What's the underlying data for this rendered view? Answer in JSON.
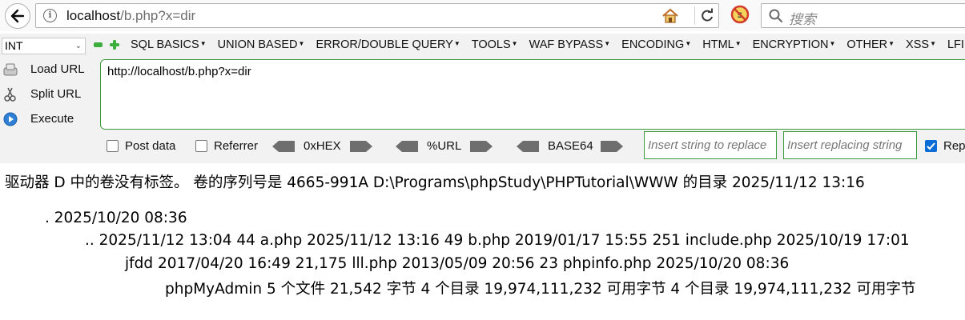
{
  "browser": {
    "url_host": "localhost",
    "url_path": "/b.php?x=dir",
    "search_placeholder": "搜索"
  },
  "hackbar": {
    "type_select": "INT",
    "menu": [
      "SQL BASICS",
      "UNION BASED",
      "ERROR/DOUBLE QUERY",
      "TOOLS",
      "WAF BYPASS",
      "ENCODING",
      "HTML",
      "ENCRYPTION",
      "OTHER",
      "XSS",
      "LFI"
    ],
    "load_url": "Load URL",
    "split_url": "Split URL",
    "execute": "Execute",
    "url_value": "http://localhost/b.php?x=dir",
    "post_data": "Post data",
    "referrer": "Referrer",
    "hex": "0xHEX",
    "urlenc": "%URL",
    "base64": "BASE64",
    "insert_string_placeholder": "Insert string to replace",
    "insert_replacing_placeholder": "Insert replacing string",
    "replace_all": "Replace All",
    "post_data_checked": false,
    "referrer_checked": false,
    "replace_checked": true
  },
  "page": {
    "lines": [
      "驱动器 D 中的卷没有标签。 卷的序列号是 4665-991A D:\\Programs\\phpStudy\\PHPTutorial\\WWW 的目录 2025/11/12 13:16",
      ". 2025/10/20 08:36",
      ".. 2025/11/12 13:04 44 a.php 2025/11/12 13:16 49 b.php 2019/01/17 15:55 251 include.php 2025/10/19 17:01",
      "jfdd 2017/04/20 16:49 21,175 lll.php 2013/05/09 20:56 23 phpinfo.php 2025/10/20 08:36",
      "phpMyAdmin 5 个文件 21,542 字节 4 个目录 19,974,111,232 可用字节 4 个目录 19,974,111,232 可用字节"
    ]
  }
}
